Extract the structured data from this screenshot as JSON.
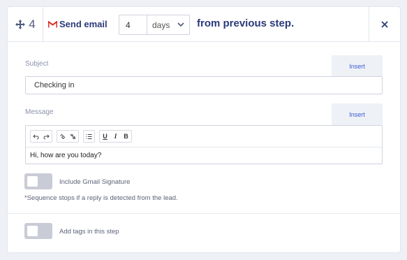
{
  "header": {
    "step_number": "4",
    "send_type_label": "Send email",
    "delay_value": "4",
    "delay_unit": "days",
    "delay_suffix": "from previous step."
  },
  "subject": {
    "label": "Subject",
    "insert_label": "Insert",
    "value": "Checking in"
  },
  "message": {
    "label": "Message",
    "insert_label": "Insert",
    "toolbar": {
      "underline": "U",
      "italic": "I",
      "bold": "B"
    },
    "body": "Hi, how are you today?"
  },
  "gmail_signature": {
    "label": "Include Gmail Signature",
    "enabled": false
  },
  "note": "*Sequence stops if a reply is detected from the lead.",
  "tags": {
    "label": "Add tags in this step",
    "enabled": false
  },
  "icons": {
    "step_drag": "move-icon",
    "send_type": "gmail-icon",
    "unit_dropdown": "chevron-down-icon",
    "close": "close-icon",
    "toolbar": [
      "undo-icon",
      "redo-icon",
      "link-icon",
      "unlink-icon",
      "bullet-list-icon"
    ]
  },
  "colors": {
    "primary_text": "#2b3a7a",
    "insert_link": "#3b5bd6",
    "gmail_red": "#d93025"
  }
}
